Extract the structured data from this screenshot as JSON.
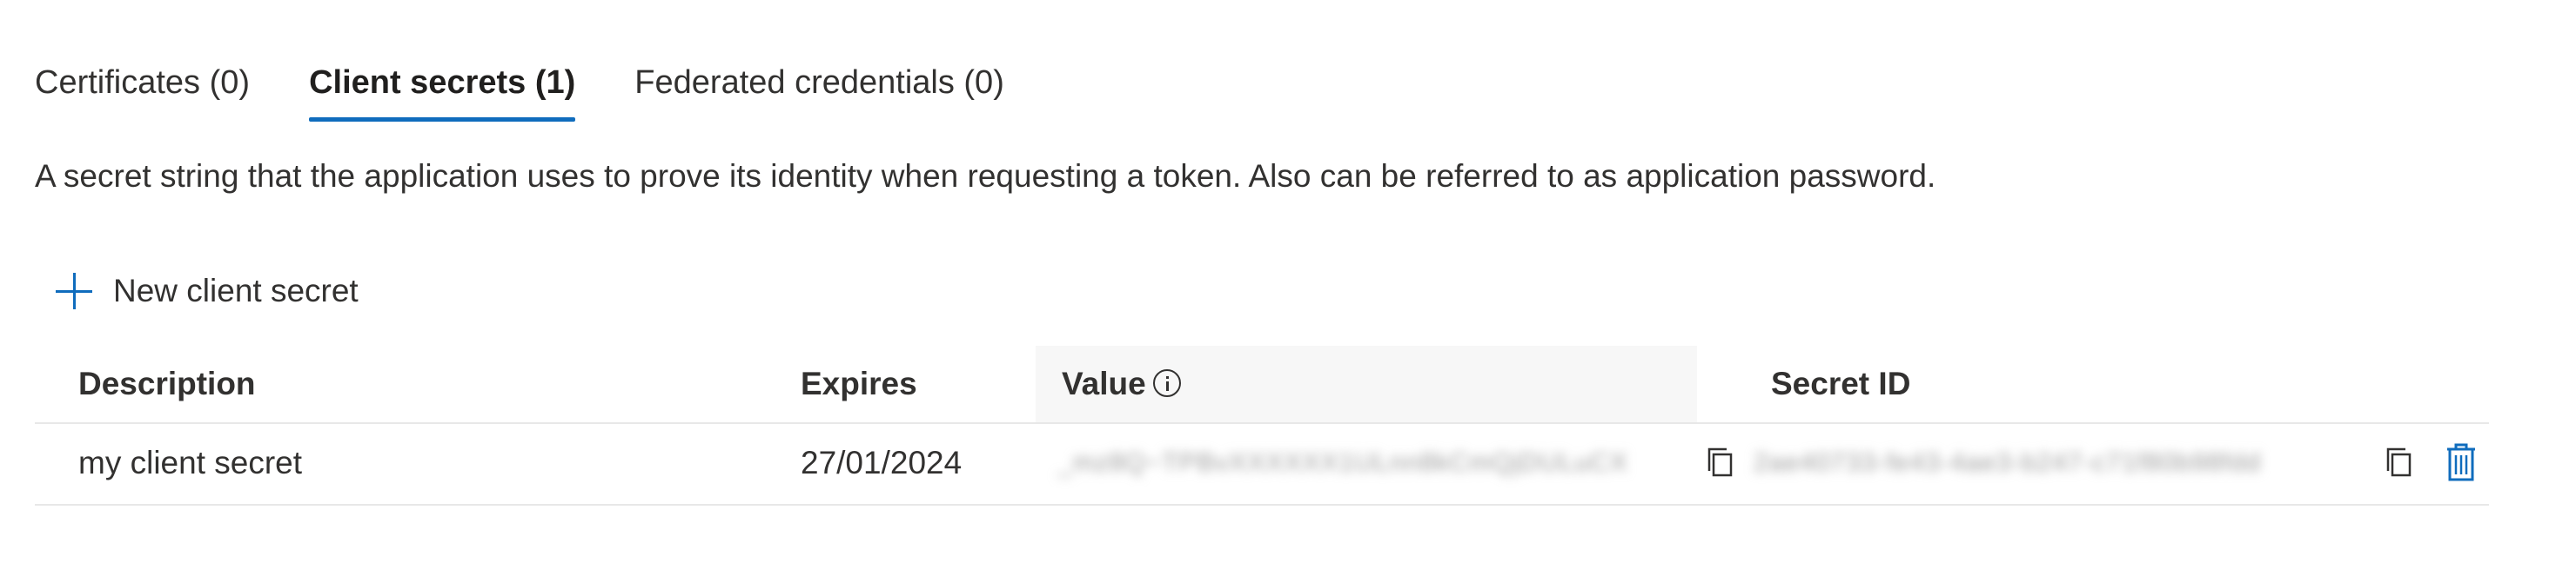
{
  "tabs": [
    {
      "label": "Certificates (0)",
      "selected": false
    },
    {
      "label": "Client secrets (1)",
      "selected": true
    },
    {
      "label": "Federated credentials (0)",
      "selected": false
    }
  ],
  "description": "A secret string that the application uses to prove its identity when requesting a token. Also can be referred to as application password.",
  "toolbar": {
    "new_secret_label": "New client secret",
    "new_secret_icon": "plus-icon"
  },
  "table": {
    "columns": [
      "Description",
      "Expires",
      "Value",
      "Secret ID"
    ],
    "rows": [
      {
        "description": "my client secret",
        "expires": "27/01/2024"
      }
    ]
  },
  "colors": {
    "accent": "#0f6cbd",
    "text": "#323130",
    "divider": "#e8e8e8"
  }
}
